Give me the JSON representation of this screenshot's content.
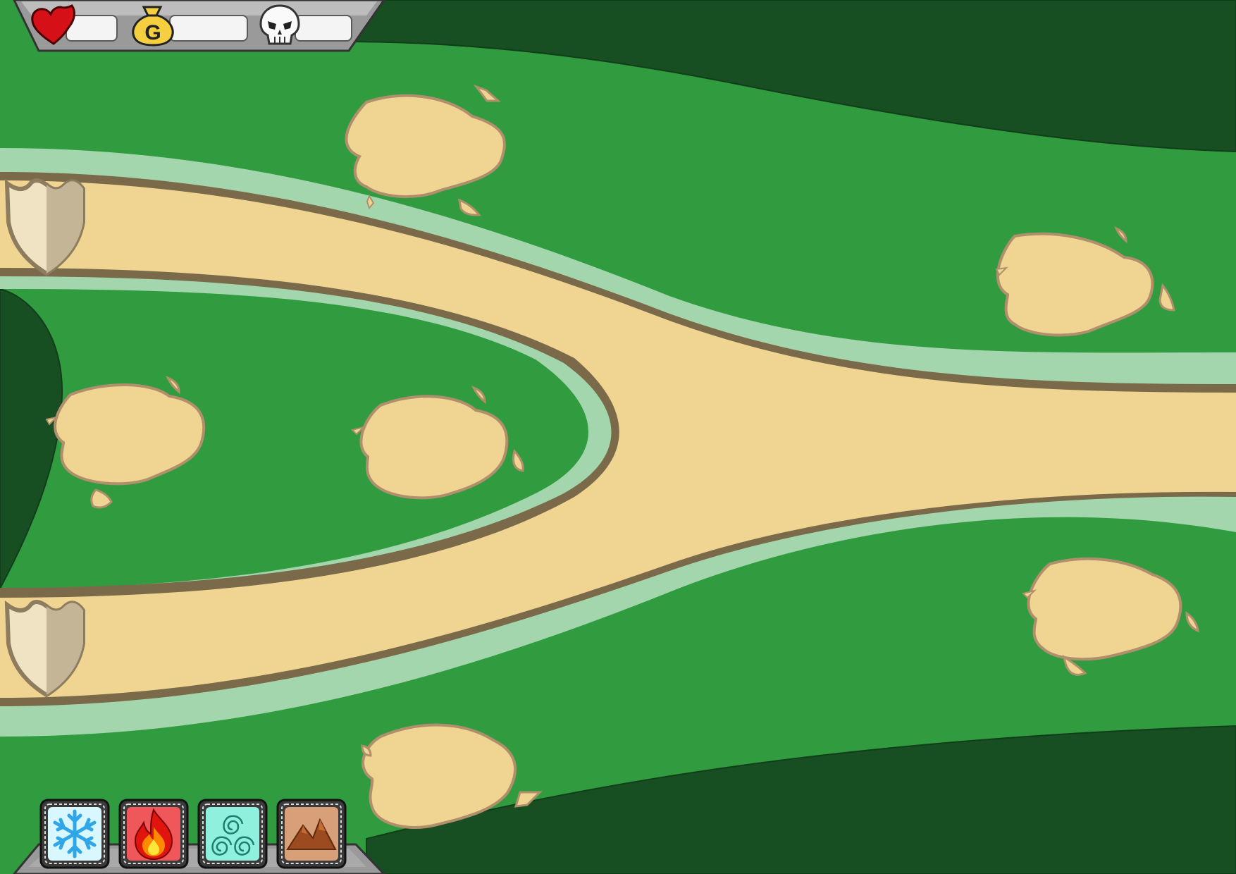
{
  "hud": {
    "lives": {
      "icon": "heart-icon",
      "value": ""
    },
    "gold": {
      "icon": "gold-bag-icon",
      "letter": "G",
      "value": ""
    },
    "kills": {
      "icon": "skull-icon",
      "value": ""
    }
  },
  "towers": [
    {
      "name": "ice-tower",
      "icon": "snowflake-icon",
      "bg": "#d9f7ff"
    },
    {
      "name": "fire-tower",
      "icon": "flame-icon",
      "bg": "#f0575b"
    },
    {
      "name": "wind-tower",
      "icon": "swirl-icon",
      "bg": "#8ff0dd"
    },
    {
      "name": "earth-tower",
      "icon": "mountain-icon",
      "bg": "#d8a079"
    }
  ],
  "colors": {
    "grass": "#309c3f",
    "dark_grass": "#174f22",
    "path": "#f0d592",
    "path_edge": "#7a6a4a",
    "path_halo": "#a3d6ad",
    "plot": "#f0d592",
    "plot_edge": "#b08f6c"
  }
}
